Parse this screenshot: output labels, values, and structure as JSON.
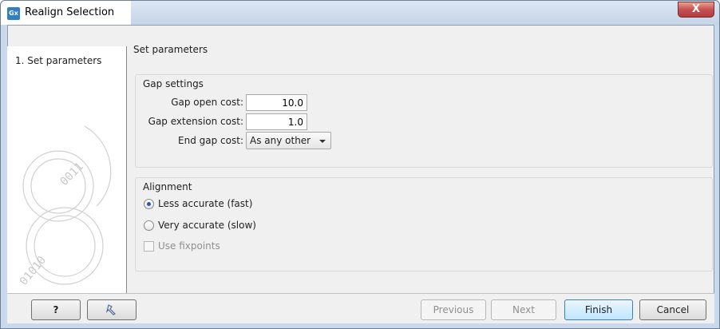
{
  "window": {
    "title": "Realign Selection",
    "app_icon_text": "Gx",
    "close_glyph": "X"
  },
  "steps": [
    {
      "number": "1.",
      "label": "Set parameters"
    }
  ],
  "panel_title": "Set parameters",
  "gap_settings": {
    "title": "Gap settings",
    "gap_open_label": "Gap open cost:",
    "gap_open_value": "10.0",
    "gap_extension_label": "Gap extension cost:",
    "gap_extension_value": "1.0",
    "end_gap_label": "End gap cost:",
    "end_gap_value": "As any other"
  },
  "alignment": {
    "title": "Alignment",
    "options": [
      {
        "label": "Less accurate (fast)",
        "selected": true
      },
      {
        "label": "Very accurate (slow)",
        "selected": false
      }
    ],
    "fixpoints_label": "Use fixpoints",
    "fixpoints_checked": false,
    "fixpoints_enabled": false
  },
  "buttons": {
    "help": "?",
    "previous": "Previous",
    "next": "Next",
    "finish": "Finish",
    "cancel": "Cancel"
  },
  "icons": {
    "help": "help-icon",
    "reset": "reset-icon"
  }
}
